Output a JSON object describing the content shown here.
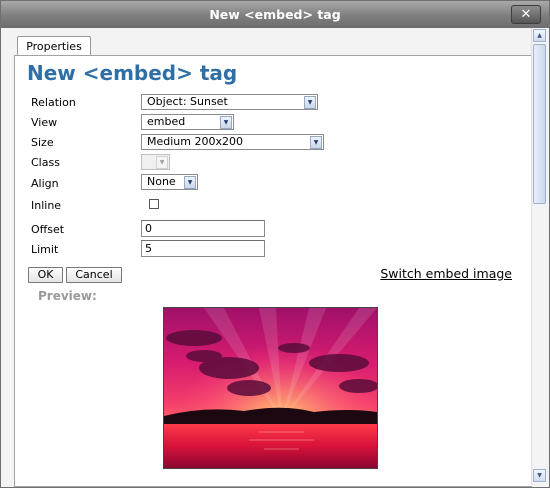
{
  "window": {
    "title": "New <embed> tag",
    "close_label": "✕"
  },
  "tabs": [
    {
      "label": "Properties",
      "selected": true
    }
  ],
  "heading": "New <embed> tag",
  "form": {
    "relation": {
      "label": "Relation",
      "value": "Object: Sunset"
    },
    "view": {
      "label": "View",
      "value": "embed"
    },
    "size": {
      "label": "Size",
      "value": "Medium 200x200"
    },
    "class": {
      "label": "Class",
      "value": "",
      "disabled": true
    },
    "align": {
      "label": "Align",
      "value": "None"
    },
    "inline": {
      "label": "Inline",
      "checked": false
    },
    "offset": {
      "label": "Offset",
      "value": "0"
    },
    "limit": {
      "label": "Limit",
      "value": "5"
    }
  },
  "actions": {
    "ok_label": "OK",
    "cancel_label": "Cancel",
    "switch_label": "Switch embed image"
  },
  "preview": {
    "label": "Preview:",
    "image": "sunset over sea"
  },
  "colors": {
    "heading": "#2f6fa5",
    "preview_label": "#9a9a9a"
  }
}
